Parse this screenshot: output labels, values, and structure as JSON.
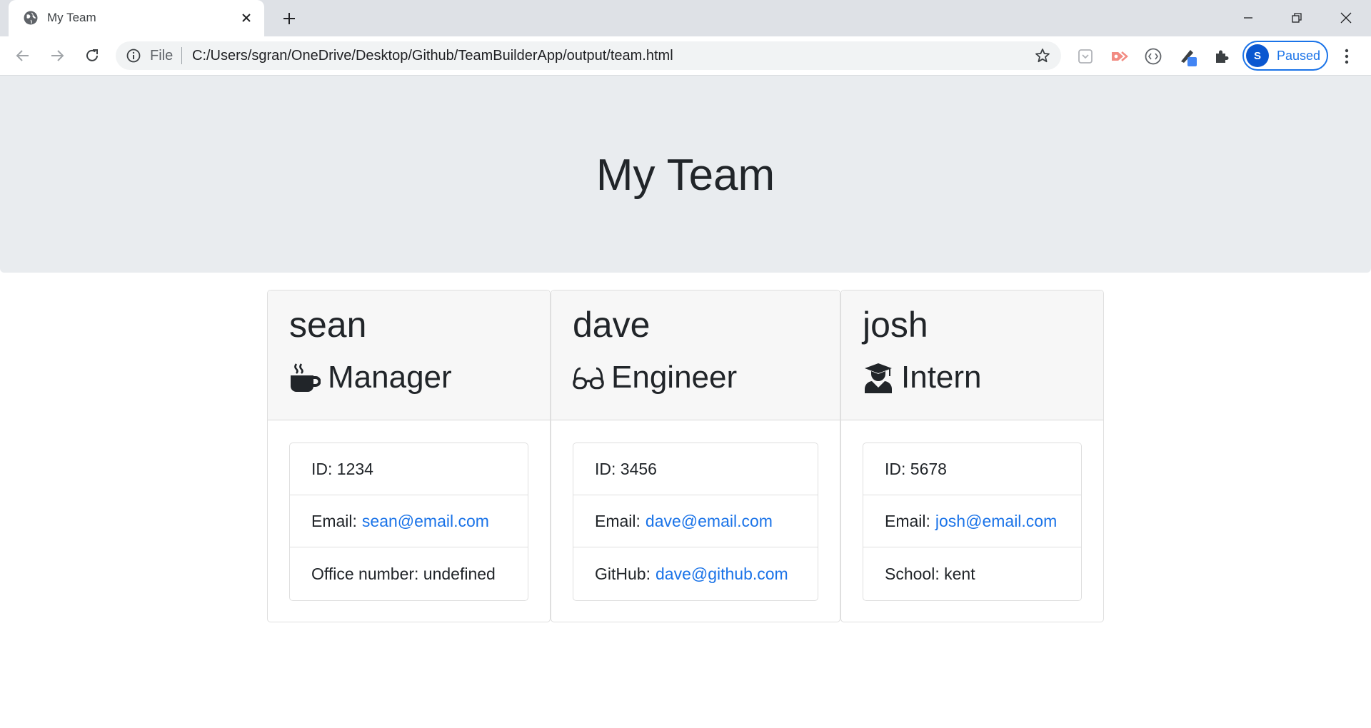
{
  "browser": {
    "tab_title": "My Team",
    "omnibox_scheme": "File",
    "url": "C:/Users/sgran/OneDrive/Desktop/Github/TeamBuilderApp/output/team.html",
    "profile_initial": "S",
    "profile_status": "Paused",
    "accent_color": "#1a73e8"
  },
  "page": {
    "title": "My Team",
    "jumbotron_color": "#e9ecef"
  },
  "team": [
    {
      "name": "sean",
      "role": "Manager",
      "role_icon": "coffee-icon",
      "id_label": "ID: 1234",
      "email_label": "Email:",
      "email": "sean@email.com",
      "extra_label": "Office number: undefined",
      "extra_link": ""
    },
    {
      "name": "dave",
      "role": "Engineer",
      "role_icon": "glasses-icon",
      "id_label": "ID: 3456",
      "email_label": "Email:",
      "email": "dave@email.com",
      "extra_label": "GitHub:",
      "extra_link": "dave@github.com"
    },
    {
      "name": "josh",
      "role": "Intern",
      "role_icon": "user-graduate-icon",
      "id_label": "ID: 5678",
      "email_label": "Email:",
      "email": "josh@email.com",
      "extra_label": "School: kent",
      "extra_link": ""
    }
  ]
}
